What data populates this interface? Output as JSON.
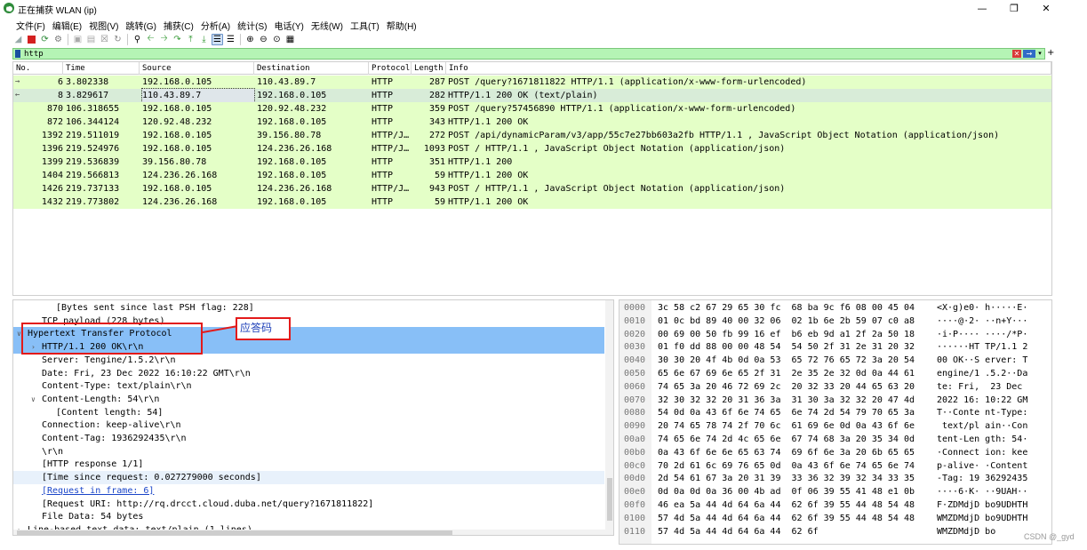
{
  "window": {
    "title": "正在捕获 WLAN (ip)",
    "minimize": "—",
    "maximize": "❐",
    "close": "✕"
  },
  "menu": [
    "文件(F)",
    "编辑(E)",
    "视图(V)",
    "跳转(G)",
    "捕获(C)",
    "分析(A)",
    "统计(S)",
    "电话(Y)",
    "无线(W)",
    "工具(T)",
    "帮助(H)"
  ],
  "toolbar_icons": [
    "shark-fin-icon",
    "stop-icon",
    "restart-icon",
    "options-icon",
    "open-icon",
    "save-icon",
    "close-file-icon",
    "reload-icon",
    "find-icon",
    "back-icon",
    "forward-icon",
    "goto-icon",
    "first-icon",
    "last-icon",
    "autoscroll-icon",
    "colorize-icon",
    "zoom-in-icon",
    "zoom-out-icon",
    "zoom-normal-icon",
    "resize-columns-icon"
  ],
  "filter": {
    "value": "http",
    "clear": "✕",
    "apply": "→",
    "dropdown": "▾",
    "add": "+"
  },
  "packet_list": {
    "columns": [
      "No.",
      "Time",
      "Source",
      "Destination",
      "Protocol",
      "Length",
      "Info"
    ],
    "rows": [
      {
        "no": "6",
        "time": "3.802338",
        "src": "192.168.0.105",
        "dst": "110.43.89.7",
        "proto": "HTTP",
        "len": "287",
        "info": "POST /query?1671811822 HTTP/1.1  (application/x-www-form-urlencoded)",
        "mark": "→"
      },
      {
        "no": "8",
        "time": "3.829617",
        "src": "110.43.89.7",
        "dst": "192.168.0.105",
        "proto": "HTTP",
        "len": "282",
        "info": "HTTP/1.1 200 OK  (text/plain)",
        "mark": "←"
      },
      {
        "no": "870",
        "time": "106.318655",
        "src": "192.168.0.105",
        "dst": "120.92.48.232",
        "proto": "HTTP",
        "len": "359",
        "info": "POST /query?57456890 HTTP/1.1  (application/x-www-form-urlencoded)",
        "mark": ""
      },
      {
        "no": "872",
        "time": "106.344124",
        "src": "120.92.48.232",
        "dst": "192.168.0.105",
        "proto": "HTTP",
        "len": "343",
        "info": "HTTP/1.1 200 OK",
        "mark": ""
      },
      {
        "no": "1392",
        "time": "219.511019",
        "src": "192.168.0.105",
        "dst": "39.156.80.78",
        "proto": "HTTP/J…",
        "len": "272",
        "info": "POST /api/dynamicParam/v3/app/55c7e27bb603a2fb HTTP/1.1 , JavaScript Object Notation (application/json)",
        "mark": ""
      },
      {
        "no": "1396",
        "time": "219.524976",
        "src": "192.168.0.105",
        "dst": "124.236.26.168",
        "proto": "HTTP/J…",
        "len": "1093",
        "info": "POST / HTTP/1.1 , JavaScript Object Notation (application/json)",
        "mark": ""
      },
      {
        "no": "1399",
        "time": "219.536839",
        "src": "39.156.80.78",
        "dst": "192.168.0.105",
        "proto": "HTTP",
        "len": "351",
        "info": "HTTP/1.1 200",
        "mark": ""
      },
      {
        "no": "1404",
        "time": "219.566813",
        "src": "124.236.26.168",
        "dst": "192.168.0.105",
        "proto": "HTTP",
        "len": "59",
        "info": "HTTP/1.1 200 OK",
        "mark": ""
      },
      {
        "no": "1426",
        "time": "219.737133",
        "src": "192.168.0.105",
        "dst": "124.236.26.168",
        "proto": "HTTP/J…",
        "len": "943",
        "info": "POST / HTTP/1.1 , JavaScript Object Notation (application/json)",
        "mark": ""
      },
      {
        "no": "1432",
        "time": "219.773802",
        "src": "124.236.26.168",
        "dst": "192.168.0.105",
        "proto": "HTTP",
        "len": "59",
        "info": "HTTP/1.1 200 OK",
        "mark": ""
      }
    ]
  },
  "details": [
    {
      "text": "[Bytes sent since last PSH flag: 228]",
      "style": "",
      "arrow": ""
    },
    {
      "text": "TCP payload (228 bytes)",
      "style": "",
      "arrow": ""
    },
    {
      "text": "Hypertext Transfer Protocol",
      "style": "hl",
      "arrow": "∨"
    },
    {
      "text": "HTTP/1.1 200 OK\\r\\n",
      "style": "hl",
      "arrow": "›"
    },
    {
      "text": "Server: Tengine/1.5.2\\r\\n",
      "style": "",
      "arrow": ""
    },
    {
      "text": "Date: Fri, 23 Dec 2022 16:10:22 GMT\\r\\n",
      "style": "",
      "arrow": ""
    },
    {
      "text": "Content-Type: text/plain\\r\\n",
      "style": "",
      "arrow": ""
    },
    {
      "text": "Content-Length: 54\\r\\n",
      "style": "",
      "arrow": "∨"
    },
    {
      "text": "[Content length: 54]",
      "style": "",
      "arrow": ""
    },
    {
      "text": "Connection: keep-alive\\r\\n",
      "style": "",
      "arrow": ""
    },
    {
      "text": "Content-Tag: 1936292435\\r\\n",
      "style": "",
      "arrow": ""
    },
    {
      "text": "\\r\\n",
      "style": "",
      "arrow": ""
    },
    {
      "text": "[HTTP response 1/1]",
      "style": "",
      "arrow": ""
    },
    {
      "text": "[Time since request: 0.027279000 seconds]",
      "style": "lt",
      "arrow": ""
    },
    {
      "text": "[Request in frame: 6]",
      "style": "link",
      "arrow": ""
    },
    {
      "text": "[Request URI: http://rq.drcct.cloud.duba.net/query?1671811822]",
      "style": "",
      "arrow": ""
    },
    {
      "text": "File Data: 54 bytes",
      "style": "",
      "arrow": ""
    },
    {
      "text": "Line-based text data: text/plain (1 lines)",
      "style": "",
      "arrow": "›"
    }
  ],
  "annotation": {
    "label": "应答码"
  },
  "hex": [
    {
      "off": "0000",
      "bytes": "3c 58 c2 67 29 65 30 fc  68 ba 9c f6 08 00 45 04",
      "ascii": "<X·g)e0· h·····E·"
    },
    {
      "off": "0010",
      "bytes": "01 0c bd 89 40 00 32 06  02 1b 6e 2b 59 07 c0 a8",
      "ascii": "····@·2· ··n+Y···"
    },
    {
      "off": "0020",
      "bytes": "00 69 00 50 fb 99 16 ef  b6 eb 9d a1 2f 2a 50 18",
      "ascii": "·i·P···· ····/*P·"
    },
    {
      "off": "0030",
      "bytes": "01 f0 dd 88 00 00 48 54  54 50 2f 31 2e 31 20 32",
      "ascii": "······HT TP/1.1 2"
    },
    {
      "off": "0040",
      "bytes": "30 30 20 4f 4b 0d 0a 53  65 72 76 65 72 3a 20 54",
      "ascii": "00 OK··S erver: T"
    },
    {
      "off": "0050",
      "bytes": "65 6e 67 69 6e 65 2f 31  2e 35 2e 32 0d 0a 44 61",
      "ascii": "engine/1 .5.2··Da"
    },
    {
      "off": "0060",
      "bytes": "74 65 3a 20 46 72 69 2c  20 32 33 20 44 65 63 20",
      "ascii": "te: Fri,  23 Dec "
    },
    {
      "off": "0070",
      "bytes": "32 30 32 32 20 31 36 3a  31 30 3a 32 32 20 47 4d",
      "ascii": "2022 16: 10:22 GM"
    },
    {
      "off": "0080",
      "bytes": "54 0d 0a 43 6f 6e 74 65  6e 74 2d 54 79 70 65 3a",
      "ascii": "T··Conte nt-Type:"
    },
    {
      "off": "0090",
      "bytes": "20 74 65 78 74 2f 70 6c  61 69 6e 0d 0a 43 6f 6e",
      "ascii": " text/pl ain··Con"
    },
    {
      "off": "00a0",
      "bytes": "74 65 6e 74 2d 4c 65 6e  67 74 68 3a 20 35 34 0d",
      "ascii": "tent-Len gth: 54·"
    },
    {
      "off": "00b0",
      "bytes": "0a 43 6f 6e 6e 65 63 74  69 6f 6e 3a 20 6b 65 65",
      "ascii": "·Connect ion: kee"
    },
    {
      "off": "00c0",
      "bytes": "70 2d 61 6c 69 76 65 0d  0a 43 6f 6e 74 65 6e 74",
      "ascii": "p-alive· ·Content"
    },
    {
      "off": "00d0",
      "bytes": "2d 54 61 67 3a 20 31 39  33 36 32 39 32 34 33 35",
      "ascii": "-Tag: 19 36292435"
    },
    {
      "off": "00e0",
      "bytes": "0d 0a 0d 0a 36 00 4b ad  0f 06 39 55 41 48 e1 0b",
      "ascii": "····6·K· ··9UAH··"
    },
    {
      "off": "00f0",
      "bytes": "46 ea 5a 44 4d 64 6a 44  62 6f 39 55 44 48 54 48",
      "ascii": "F·ZDMdjD bo9UDHTH"
    },
    {
      "off": "0100",
      "bytes": "57 4d 5a 44 4d 64 6a 44  62 6f 39 55 44 48 54 48",
      "ascii": "WMZDMdjD bo9UDHTH"
    },
    {
      "off": "0110",
      "bytes": "57 4d 5a 44 4d 64 6a 44  62 6f",
      "ascii": "WMZDMdjD bo"
    }
  ],
  "watermark": "CSDN @_gyd"
}
